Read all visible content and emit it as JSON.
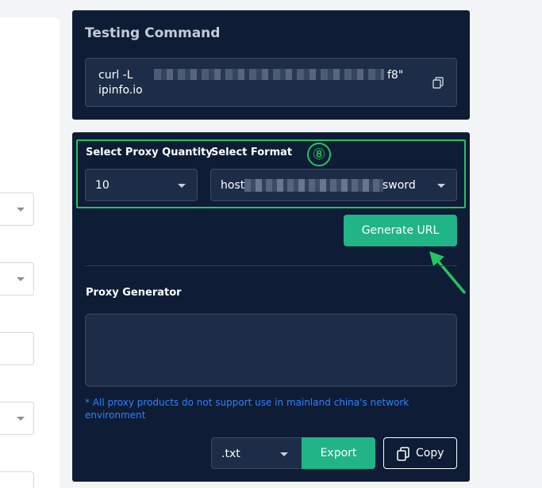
{
  "command": {
    "title": "Testing Command",
    "line1_prefix": "curl -L",
    "line1_suffix": "f8\"",
    "line2": "ipinfo.io",
    "copy_icon": "copy-icon"
  },
  "generator": {
    "quantity_label": "Select Proxy Quantity",
    "quantity_value": "10",
    "format_label": "Select Format",
    "format_value_prefix": "host",
    "format_value_suffix": "sword",
    "step_number": "⑧",
    "generate_button": "Generate URL",
    "proxy_generator_label": "Proxy Generator",
    "textarea_value": "",
    "note": "* All proxy products do not support use in mainland china's network environment",
    "export_format": ".txt",
    "export_button": "Export",
    "copy_button": "Copy"
  },
  "colors": {
    "panel": "#0e1c36",
    "accent": "#20b486",
    "highlight": "#22c55e",
    "note": "#2b82ff"
  }
}
